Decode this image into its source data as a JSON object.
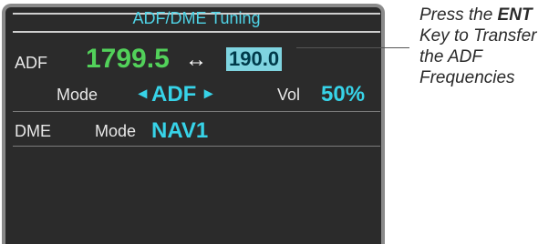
{
  "panel": {
    "title": "ADF/DME Tuning",
    "adf": {
      "label": "ADF",
      "active_freq": "1799.5",
      "swap_symbol": "↔",
      "standby_freq": "190.0",
      "mode_label": "Mode",
      "mode_left_arrow": "◂",
      "mode_value": "ADF",
      "mode_right_arrow": "▸",
      "vol_label": "Vol",
      "vol_value": "50%"
    },
    "dme": {
      "label": "DME",
      "mode_label": "Mode",
      "mode_value": "NAV1"
    }
  },
  "callout": {
    "prefix": "Press the ",
    "key": "ENT",
    "rest": " Key to Transfer the ADF Frequencies"
  },
  "colors": {
    "active": "#52d15a",
    "cyan": "#37d3e8",
    "standby_bg": "#7fd4e0",
    "panel_bg": "#2b2b2b"
  }
}
